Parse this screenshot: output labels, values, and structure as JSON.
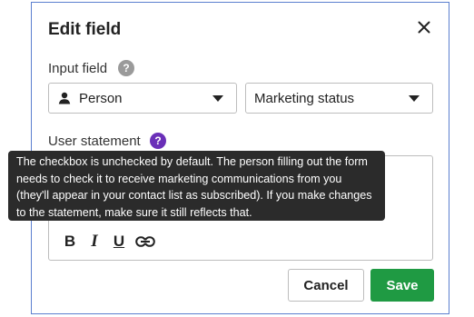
{
  "dialog": {
    "title": "Edit field",
    "close_icon": "close-icon"
  },
  "input_field": {
    "label": "Input field",
    "help_icon": "question-circle-icon",
    "source_select": {
      "value": "Person",
      "icon": "person-icon"
    },
    "field_select": {
      "value": "Marketing status"
    }
  },
  "statement": {
    "label": "User statement",
    "help_icon": "question-circle-icon",
    "tooltip": "The checkbox is unchecked by default. The person filling out the form needs to check it to receive marketing communications from you (they'll appear in your contact list as subscribed). If you make changes to the statement, make sure it still reflects that.",
    "toolbar": {
      "bold": "B",
      "italic": "I",
      "underline": "U",
      "link_icon": "link-icon"
    }
  },
  "buttons": {
    "cancel": "Cancel",
    "save": "Save"
  },
  "colors": {
    "save_green": "#1f9a43",
    "help_purple": "#6a2fb8",
    "dialog_border": "#5b7fcf",
    "tooltip_bg": "#2b2b2b"
  }
}
